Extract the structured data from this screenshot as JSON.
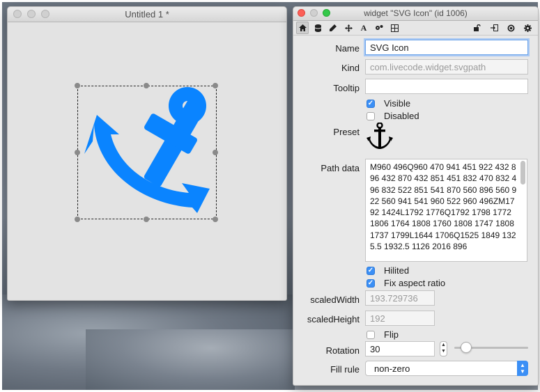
{
  "left_window": {
    "title": "Untitled 1 *",
    "widget": {
      "icon": "anchor-icon",
      "color": "#0a84ff"
    }
  },
  "inspector": {
    "title": "widget \"SVG Icon\" (id 1006)",
    "toolbar_left_icons": [
      "home-icon",
      "database-icon",
      "pencil-icon",
      "move-icon",
      "text-format-icon",
      "gear-options-icon",
      "grid-move-icon"
    ],
    "toolbar_right_icons": [
      "lock-icon",
      "exit-icon",
      "target-icon",
      "settings-icon"
    ],
    "fields": {
      "name_label": "Name",
      "name_value": "SVG Icon",
      "kind_label": "Kind",
      "kind_value": "com.livecode.widget.svgpath",
      "tooltip_label": "Tooltip",
      "tooltip_value": "",
      "visible_label": "Visible",
      "visible_checked": true,
      "disabled_label": "Disabled",
      "disabled_checked": false,
      "preset_label": "Preset",
      "preset_icon": "anchor-icon",
      "path_data_label": "Path data",
      "path_data_value": "M960 496Q960 470 941 451 922 432 896 432 870 432 851 451 832 470 832 496 832 522 851 541 870 560 896 560 922 560 941 541 960 522 960 496ZM1792 1424L1792 1776Q1792 1798 1772 1806 1764 1808 1760 1808 1747 1808 1737 1799L1644 1706Q1525 1849 1325.5 1932.5 1126 2016 896",
      "hilited_label": "Hilited",
      "hilited_checked": true,
      "fix_aspect_label": "Fix aspect ratio",
      "fix_aspect_checked": true,
      "scaled_width_label": "scaledWidth",
      "scaled_width_value": "193.729736",
      "scaled_height_label": "scaledHeight",
      "scaled_height_value": "192",
      "flip_label": "Flip",
      "flip_checked": false,
      "rotation_label": "Rotation",
      "rotation_value": "30",
      "rotation_slider_fraction": 0.08,
      "fill_rule_label": "Fill rule",
      "fill_rule_value": "non-zero"
    }
  }
}
